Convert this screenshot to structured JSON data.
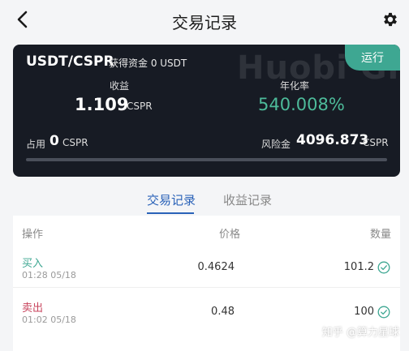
{
  "header": {
    "title": "交易记录",
    "back_icon": "chevron-left-icon",
    "settings_icon": "gear-icon"
  },
  "card": {
    "watermark": "Huobi Gl",
    "status_badge": "运行",
    "pair": "USDT/CSPR",
    "fund_text": "获得资金 0 USDT",
    "profit_label": "收益",
    "profit_value": "1.109",
    "profit_unit": "CSPR",
    "apr_label": "年化率",
    "apr_value": "540.008%",
    "occupy_label": "占用",
    "occupy_value": "0",
    "occupy_unit": "CSPR",
    "risk_label": "风险金",
    "risk_value": "4096.873",
    "risk_unit": "CSPR",
    "progress_fraction": 0
  },
  "tabs": [
    {
      "label": "交易记录",
      "active": true
    },
    {
      "label": "收益记录",
      "active": false
    }
  ],
  "table": {
    "headers": {
      "action": "操作",
      "price": "价格",
      "qty": "数量"
    },
    "rows": [
      {
        "action": "买入",
        "time": "01:28 05/18",
        "price": "0.4624",
        "qty": "101.2",
        "type": "buy",
        "status_icon": "check-circle-icon"
      },
      {
        "action": "卖出",
        "time": "01:02 05/18",
        "price": "0.48",
        "qty": "100",
        "type": "sell",
        "status_icon": "check-circle-icon"
      }
    ]
  },
  "credit": "知乎 @算力星球",
  "colors": {
    "accent_blue": "#2a62b8",
    "green": "#3ea792",
    "red": "#c8455e",
    "card_bg": "#171b24"
  }
}
